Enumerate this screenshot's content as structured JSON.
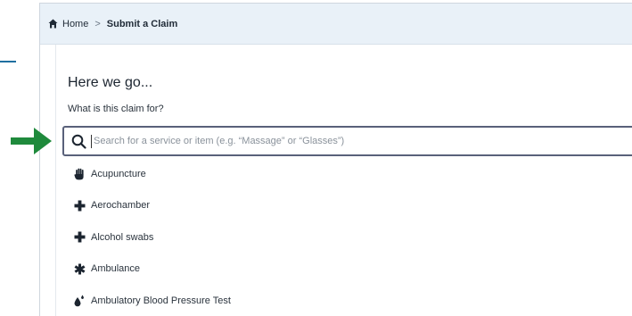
{
  "breadcrumb": {
    "home": "Home",
    "separator": ">",
    "current": "Submit a Claim"
  },
  "panel": {
    "heading": "Here we go...",
    "question": "What is this claim for?"
  },
  "search": {
    "value": "",
    "placeholder": "Search for a service or item (e.g. “Massage” or “Glasses”)"
  },
  "options": [
    {
      "label": "Acupuncture",
      "icon": "hand-icon"
    },
    {
      "label": "Aerochamber",
      "icon": "plus-icon"
    },
    {
      "label": "Alcohol swabs",
      "icon": "plus-icon"
    },
    {
      "label": "Ambulance",
      "icon": "asterisk-icon"
    },
    {
      "label": "Ambulatory Blood Pressure Test",
      "icon": "drop-icon"
    }
  ],
  "colors": {
    "arrow": "#1f8a3c",
    "breadcrumb_bg": "#e9f1f8",
    "search_border": "#59617a",
    "accent_dash": "#1f6fa0"
  }
}
